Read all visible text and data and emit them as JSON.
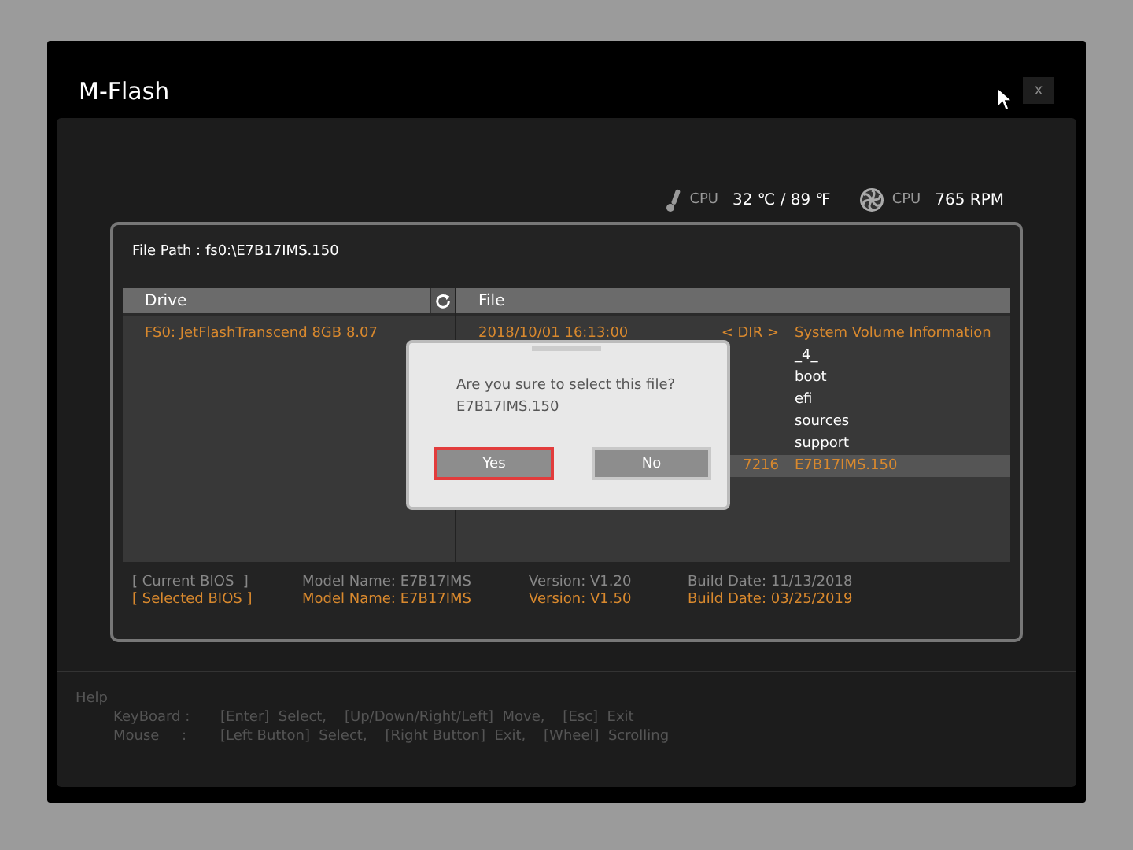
{
  "window": {
    "title": "M-Flash",
    "close": "x"
  },
  "sensors": [
    {
      "kind": "temperature",
      "label": "CPU",
      "value": "32 ℃ / 89 ℉"
    },
    {
      "kind": "fan",
      "label": "CPU",
      "value": "765 RPM"
    }
  ],
  "file_path": {
    "label": "File Path :",
    "value": "fs0:\\E7B17IMS.150"
  },
  "drives": {
    "header": "Drive",
    "items": [
      {
        "name": "FS0: JetFlashTranscend 8GB 8.07"
      }
    ]
  },
  "files": {
    "header": "File",
    "rows": [
      {
        "date": "2018/10/01 16:13:00",
        "size": "< DIR >",
        "name": "System Volume Information",
        "selected": false
      },
      {
        "name": "_4_",
        "selected": false
      },
      {
        "name": "boot",
        "selected": false
      },
      {
        "name": "efi",
        "selected": false
      },
      {
        "name": "sources",
        "selected": false
      },
      {
        "name": "support",
        "selected": false
      },
      {
        "size": "7216",
        "name": "E7B17IMS.150",
        "selected": true
      }
    ]
  },
  "bios": [
    {
      "kind": "current",
      "label": "[ Current BIOS  ]",
      "model": "Model Name: E7B17IMS",
      "version": "Version: V1.20",
      "build": "Build Date: 11/13/2018"
    },
    {
      "kind": "selected",
      "label": "[ Selected BIOS ]",
      "model": "Model Name: E7B17IMS",
      "version": "Version: V1.50",
      "build": "Build Date: 03/25/2019"
    }
  ],
  "dialog": {
    "message": "Are you sure to select this file?",
    "file": "E7B17IMS.150",
    "buttons": [
      {
        "label": "Yes",
        "selected": true
      },
      {
        "label": "No",
        "selected": false
      }
    ]
  },
  "help": {
    "title": "Help",
    "lines": [
      {
        "label": "KeyBoard :",
        "text": "[Enter]  Select,    [Up/Down/Right/Left]  Move,    [Esc]  Exit"
      },
      {
        "label": "Mouse     :",
        "text": "[Left Button]  Select,    [Right Button]  Exit,    [Wheel]  Scrolling"
      }
    ]
  }
}
